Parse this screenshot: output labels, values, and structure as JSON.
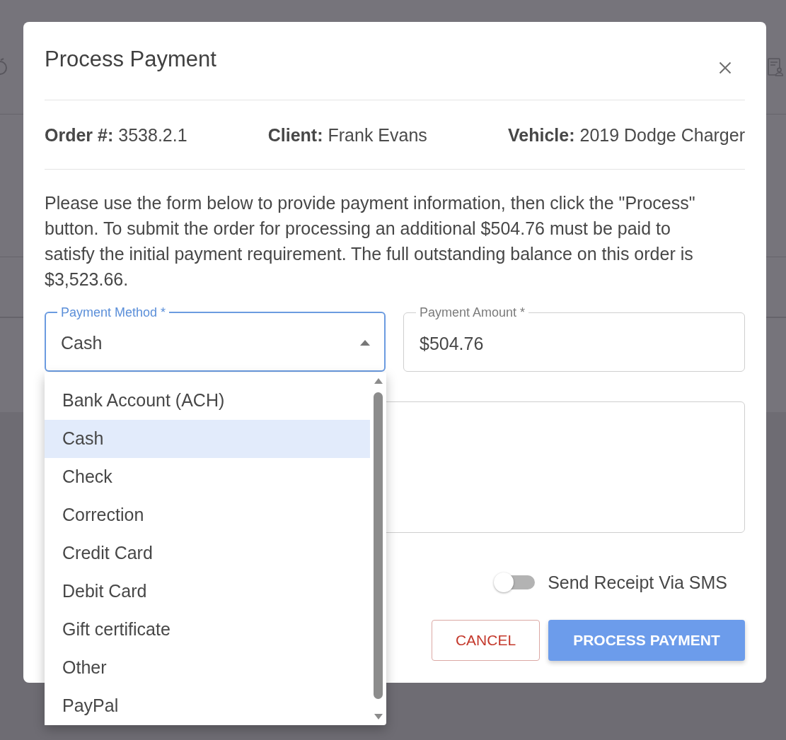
{
  "dialog": {
    "title": "Process Payment"
  },
  "summary": [
    {
      "label": "Order #:",
      "value": "3538.2.1"
    },
    {
      "label": "Client:",
      "value": "Frank Evans"
    },
    {
      "label": "Vehicle:",
      "value": "2019 Dodge Charger"
    }
  ],
  "instructions": "Please use the form below to provide payment information, then click the \"Process\" button. To submit the order for processing an additional $504.76 must be paid to satisfy the initial payment requirement. The full outstanding balance on this order is $3,523.66.",
  "payment_method": {
    "label": "Payment Method *",
    "value": "Cash",
    "focused": true,
    "expanded": true,
    "options": [
      {
        "label": "Bank Account (ACH)",
        "selected": false
      },
      {
        "label": "Cash",
        "selected": true
      },
      {
        "label": "Check",
        "selected": false
      },
      {
        "label": "Correction",
        "selected": false
      },
      {
        "label": "Credit Card",
        "selected": false
      },
      {
        "label": "Debit Card",
        "selected": false
      },
      {
        "label": "Gift certificate",
        "selected": false
      },
      {
        "label": "Other",
        "selected": false
      },
      {
        "label": "PayPal",
        "selected": false
      }
    ]
  },
  "payment_amount": {
    "label": "Payment Amount *",
    "value": "$504.76",
    "focused": false
  },
  "sms_receipt": {
    "label": "Send Receipt Via SMS",
    "on": false
  },
  "buttons": [
    {
      "label": "CANCEL",
      "kind": "outline"
    },
    {
      "label": "PROCESS PAYMENT",
      "kind": "primary"
    }
  ]
}
